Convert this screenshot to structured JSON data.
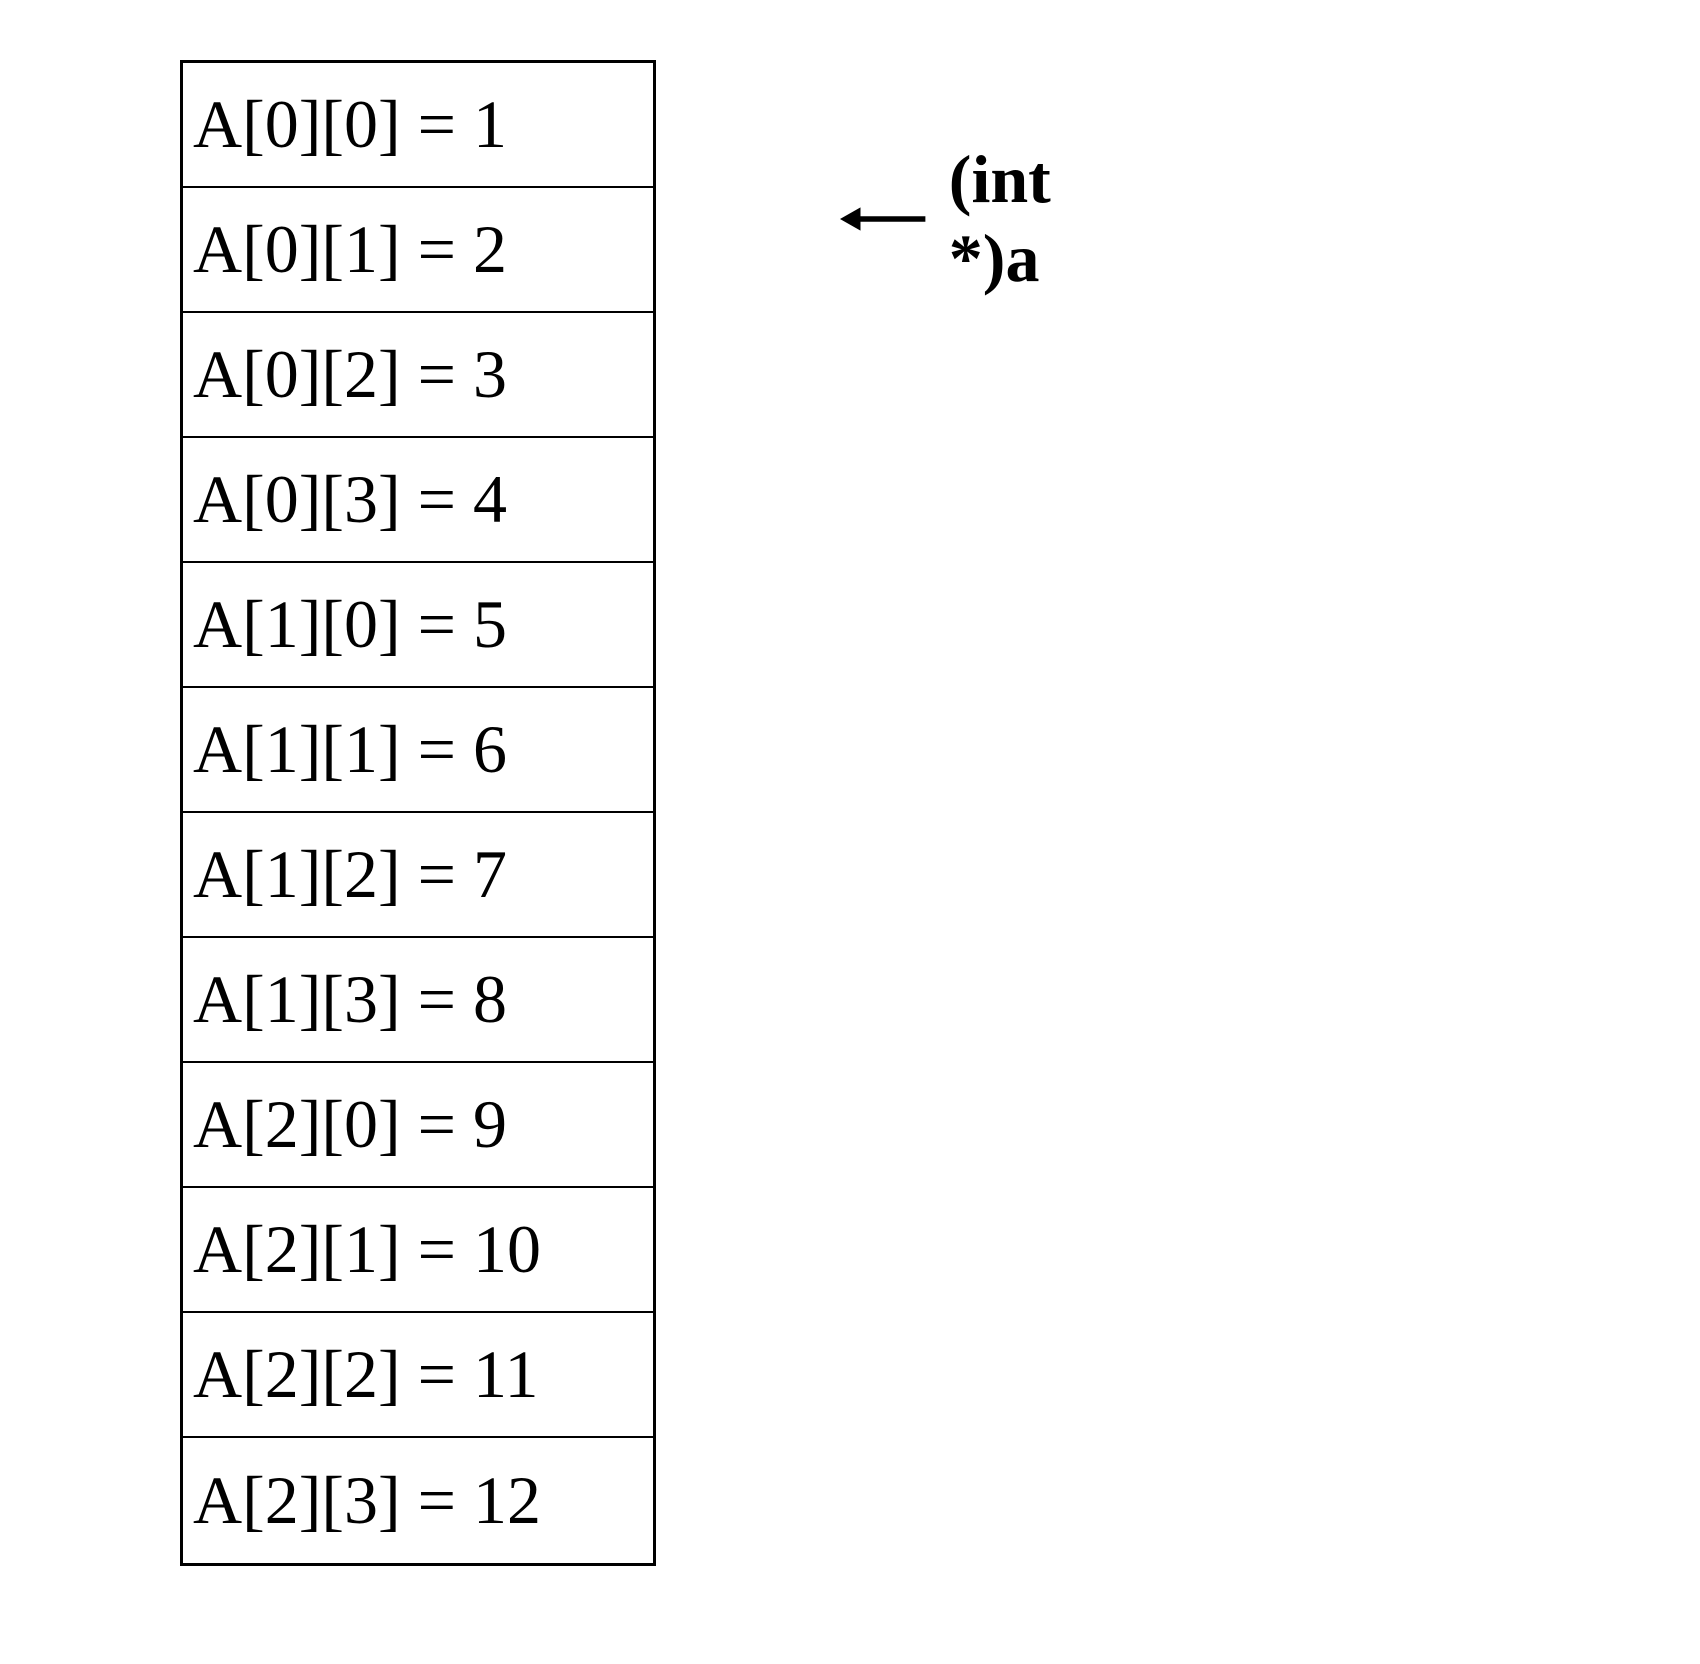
{
  "diagram": {
    "cells": [
      "A[0][0] = 1",
      "A[0][1] = 2",
      "A[0][2] = 3",
      "A[0][3] = 4",
      "A[1][0] = 5",
      "A[1][1] = 6",
      "A[1][2] = 7",
      "A[1][3] = 8",
      "A[2][0] = 9",
      "A[2][1] = 10",
      "A[2][2] = 11",
      "A[2][3] = 12"
    ],
    "pointer_label": "(int *)a"
  },
  "chart_data": {
    "type": "table",
    "description": "2D array memory layout (row-major) with pointer annotation",
    "array_name": "A",
    "pointer_cast": "(int *)a",
    "rows": 3,
    "cols": 4,
    "cells": [
      {
        "row": 0,
        "col": 0,
        "value": 1
      },
      {
        "row": 0,
        "col": 1,
        "value": 2
      },
      {
        "row": 0,
        "col": 2,
        "value": 3
      },
      {
        "row": 0,
        "col": 3,
        "value": 4
      },
      {
        "row": 1,
        "col": 0,
        "value": 5
      },
      {
        "row": 1,
        "col": 1,
        "value": 6
      },
      {
        "row": 1,
        "col": 2,
        "value": 7
      },
      {
        "row": 1,
        "col": 3,
        "value": 8
      },
      {
        "row": 2,
        "col": 0,
        "value": 9
      },
      {
        "row": 2,
        "col": 1,
        "value": 10
      },
      {
        "row": 2,
        "col": 2,
        "value": 11
      },
      {
        "row": 2,
        "col": 3,
        "value": 12
      }
    ],
    "pointer_target_index": 0
  }
}
